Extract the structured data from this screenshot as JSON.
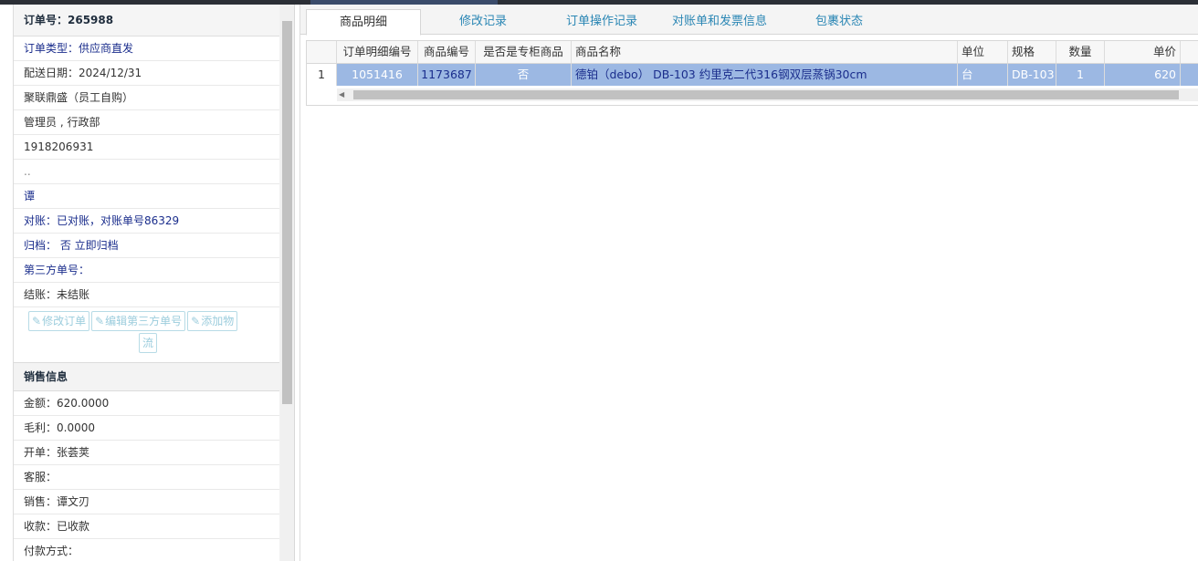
{
  "order": {
    "title": "订单号：265988",
    "rows": [
      {
        "text": "订单类型：供应商直发",
        "style": "blue"
      },
      {
        "text": "配送日期：2024/12/31",
        "style": ""
      },
      {
        "text": "聚联鼎盛（员工自购）",
        "style": ""
      },
      {
        "text": "管理员 , 行政部",
        "style": ""
      },
      {
        "text": "1918206931",
        "style": ""
      },
      {
        "text": "..",
        "style": "dim"
      },
      {
        "text": "谭",
        "style": "blue"
      },
      {
        "text": "对账：已对账，对账单号86329",
        "style": "blue"
      },
      {
        "text": "归档：  否 立即归档",
        "style": "blue"
      },
      {
        "text": "第三方单号：",
        "style": "blue"
      },
      {
        "text": "结账：未结账",
        "style": ""
      }
    ],
    "buttons": {
      "edit_order": "修改订单",
      "edit_third_party": "编辑第三方单号",
      "add_logistics_1": "添加物",
      "add_logistics_2": "流"
    }
  },
  "sales": {
    "title": "销售信息",
    "rows": [
      "金额：620.0000",
      "毛利：0.0000",
      "开单：张荟荚",
      "客服：",
      "销售：谭文刃",
      "收款：已收款",
      "付款方式："
    ]
  },
  "tabs": [
    {
      "label": "商品明细",
      "active": true
    },
    {
      "label": "修改记录",
      "active": false
    },
    {
      "label": "订单操作记录",
      "active": false
    },
    {
      "label": "对账单和发票信息",
      "active": false
    },
    {
      "label": "包裹状态",
      "active": false
    }
  ],
  "grid": {
    "headers": [
      "订单明细编号",
      "商品编号",
      "是否是专柜商品",
      "商品名称",
      "单位",
      "规格",
      "数量",
      "单价"
    ],
    "rows": [
      {
        "index": "1",
        "cells": [
          "1051416",
          "1173687",
          "否",
          "德铂（debo） DB-103 约里克二代316钢双层蒸锅30cm",
          "台",
          "DB-103",
          "1",
          "620"
        ]
      }
    ]
  },
  "colors": {
    "link": "#1a2d8c",
    "tab_link": "#2a86b4",
    "selected_row": "#9cb8e3",
    "disabled_button": "#9ccddd"
  },
  "icons": {
    "edit_button_icon": "edit-icon",
    "scroll_left_icon": "arrow-left-icon"
  }
}
